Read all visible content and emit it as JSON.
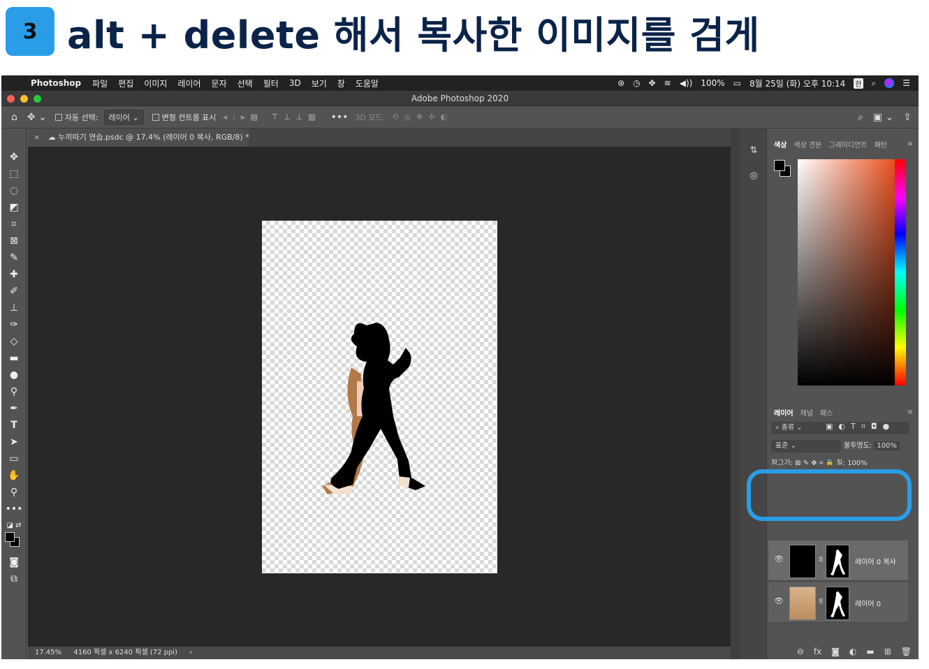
{
  "heading": {
    "step": "3",
    "text": "alt + delete 해서 복사한 이미지를 검게"
  },
  "menubar": {
    "app_name": "Photoshop",
    "items": [
      "파일",
      "편집",
      "이미지",
      "레이어",
      "문자",
      "선택",
      "필터",
      "3D",
      "보기",
      "창",
      "도움말"
    ],
    "battery": "100%",
    "datetime": "8월 25일 (화) 오후 10:14",
    "input_method": "한"
  },
  "window": {
    "title": "Adobe Photoshop 2020"
  },
  "options_bar": {
    "auto_select_label": "자동 선택:",
    "auto_select_value": "레이어",
    "transform_label": "변형 컨트롤 표시",
    "mode_3d": "3D 모드:"
  },
  "document": {
    "tab_title": "누끼따기 연습.psdc @ 17.4% (레이어 0 복사, RGB/8) *",
    "zoom": "17.45%",
    "doc_info": "4160 픽셀 x 6240 픽셀 (72 ppi)"
  },
  "color_panel": {
    "tabs": [
      "색상",
      "색상 견본",
      "그레이디언트",
      "패턴"
    ],
    "accent": "#e8501e"
  },
  "layers_panel": {
    "tabs": [
      "레이어",
      "채널",
      "패스"
    ],
    "filter_label": "종류",
    "blend_mode": "표준",
    "opacity_label": "불투명도:",
    "opacity_value": "100%",
    "lock_label": "잠그기:",
    "fill_label": "칠:",
    "fill_value": "100%",
    "layers": [
      {
        "name": "레이어 0 복사",
        "selected": true
      },
      {
        "name": "레이어 0",
        "selected": false
      }
    ]
  },
  "highlight_color": "#2a9de8"
}
